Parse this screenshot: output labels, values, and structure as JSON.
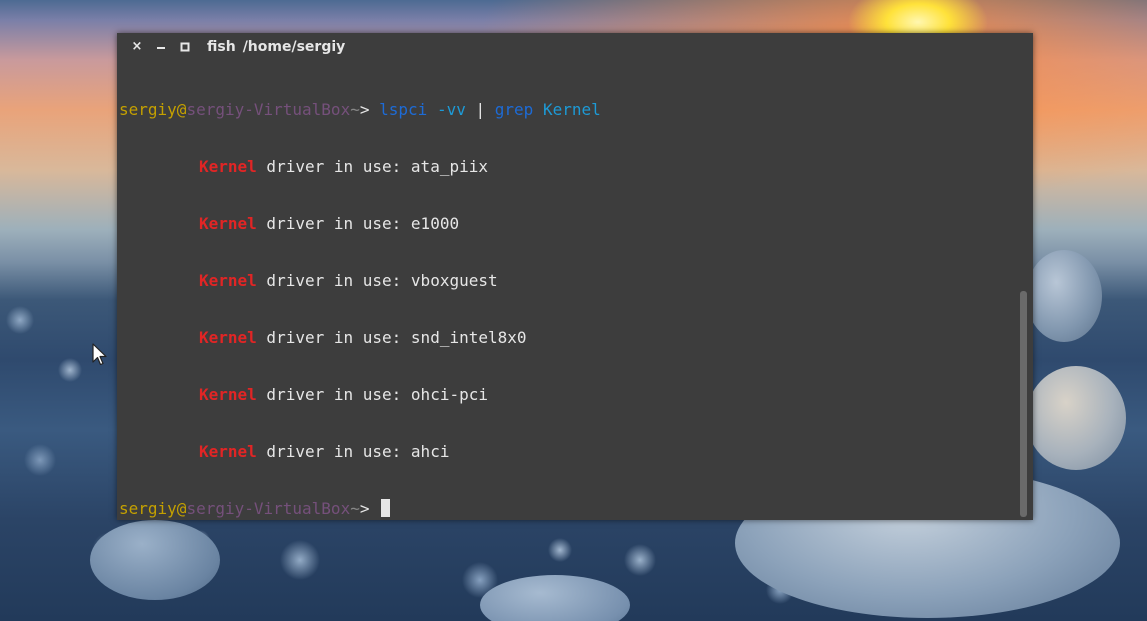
{
  "window": {
    "title_app": "fish",
    "title_path": "/home/sergiy",
    "close_glyph": "×",
    "minimize_icon": "minimize-icon",
    "maximize_icon": "maximize-icon"
  },
  "prompt": {
    "user": "sergiy",
    "at": "@",
    "host": "sergiy-VirtualBox",
    "tilde": "~",
    "symbol": ">"
  },
  "command": {
    "cmd1": "lspci",
    "arg1": "-vv",
    "pipe": "|",
    "cmd2": "grep",
    "arg2": "Kernel"
  },
  "output": [
    {
      "keyword": "Kernel",
      "rest": " driver in use: ata_piix"
    },
    {
      "keyword": "Kernel",
      "rest": " driver in use: e1000"
    },
    {
      "keyword": "Kernel",
      "rest": " driver in use: vboxguest"
    },
    {
      "keyword": "Kernel",
      "rest": " driver in use: snd_intel8x0"
    },
    {
      "keyword": "Kernel",
      "rest": " driver in use: ohci-pci"
    },
    {
      "keyword": "Kernel",
      "rest": " driver in use: ahci"
    }
  ],
  "colors": {
    "terminal_bg": "#3d3d3d",
    "user": "#c4a000",
    "host": "#75507b",
    "command": "#1d6bd6",
    "argument": "#1d9ad6",
    "kernel_highlight": "#e12525"
  },
  "icons": [
    "close-icon",
    "minimize-icon",
    "maximize-icon",
    "mouse-pointer-icon"
  ]
}
